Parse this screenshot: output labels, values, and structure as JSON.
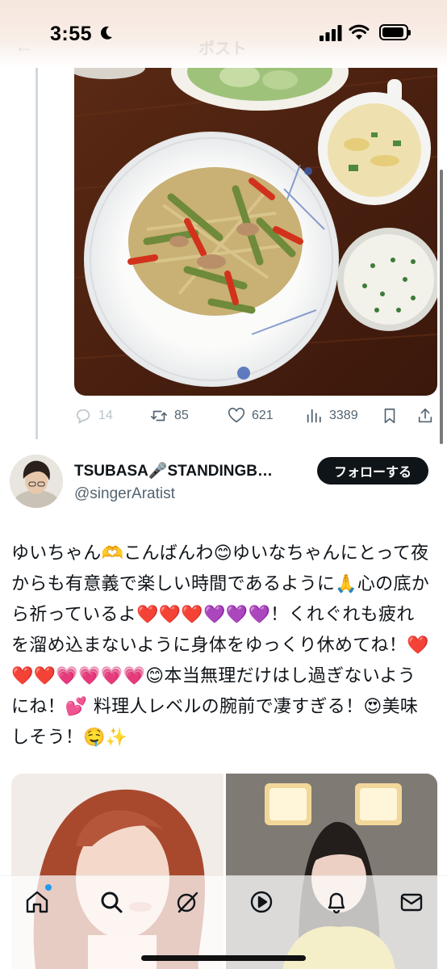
{
  "status_bar": {
    "time": "3:55",
    "ghost_title": "ポスト"
  },
  "post": {
    "stats": {
      "replies": "14",
      "retweets": "85",
      "likes": "621",
      "views": "3389"
    }
  },
  "reply": {
    "author_name": "TSUBASA🎤STANDINGB…",
    "author_handle": "@singerAratist",
    "follow_label": "フォローする",
    "text": "ゆいちゃん🫶こんばんわ😊ゆいなちゃんにとって夜からも有意義で楽しい時間であるように🙏心の底から祈っているよ❤️❤️❤️💜💜💜！くれぐれも疲れを溜め込まないように身体をゆっくり休めてね！❤️❤️❤️💗💗💗💗😊本当無理だけはし過ぎないようにね！💕 料理人レベルの腕前で凄すぎる！😍美味しそう！🤤✨"
  },
  "nav": {
    "items": [
      "home-icon",
      "search-icon",
      "grok-icon",
      "video-icon",
      "notifications-icon",
      "messages-icon"
    ]
  },
  "colors": {
    "text": "#0f1419",
    "muted": "#536471",
    "follow_bg": "#0f1419",
    "accent_dot": "#1d9bf0"
  }
}
